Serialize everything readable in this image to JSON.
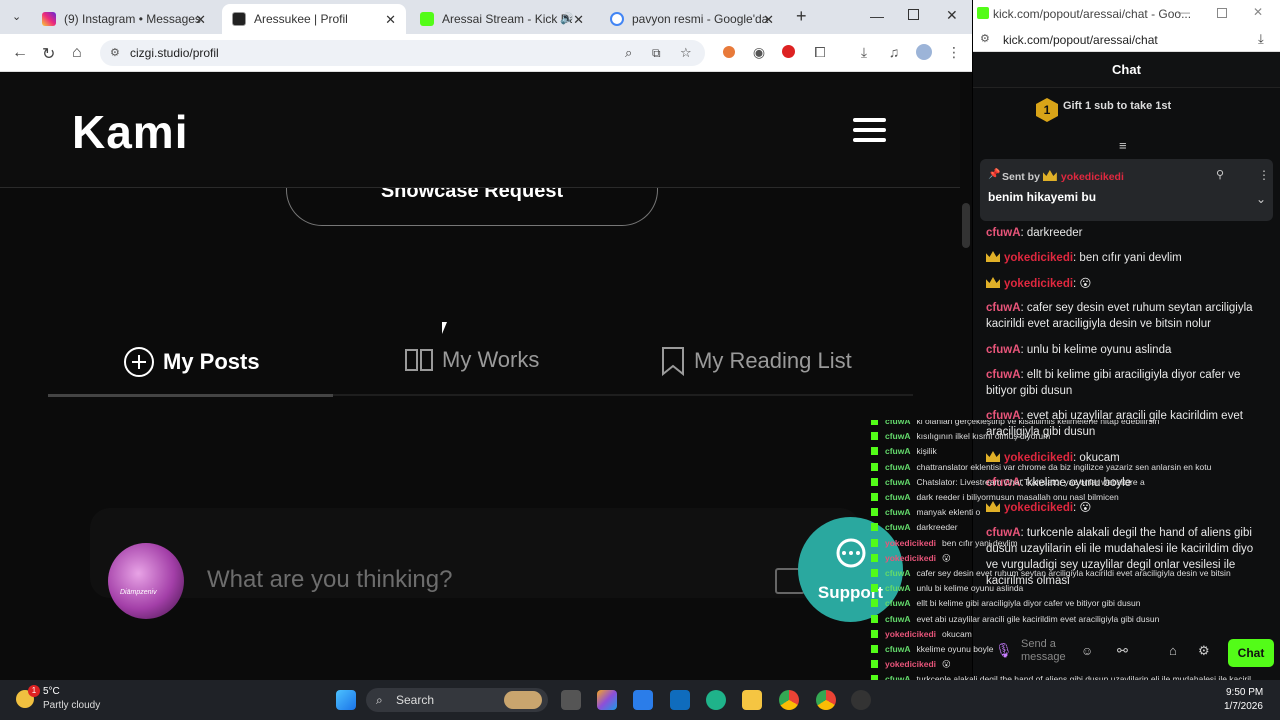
{
  "browser": {
    "tabs": [
      {
        "label": "(9) Instagram • Messages",
        "color": "#d6249f"
      },
      {
        "label": "Aressukee | Profil",
        "color": "#111111"
      },
      {
        "label": "Aressai Stream - Kick Das",
        "color": "#53fc18"
      },
      {
        "label": "pavyon resmi - Google'da ara",
        "color": "#4285f4"
      }
    ],
    "url": "cizgi.studio/profil",
    "new_tab": "+"
  },
  "site": {
    "logo": "Kami",
    "showcase_button": "Showcase Request",
    "tabs": [
      "My Posts",
      "My Works",
      "My Reading List"
    ],
    "post_placeholder": "What are you thinking?",
    "avatar_text": "Diämpzeniv",
    "support_label": "Support"
  },
  "chat": {
    "window_title": "kick.com/popout/aressai/chat - Goo...",
    "url": "kick.com/popout/aressai/chat",
    "header": "Chat",
    "gift_badge": "1",
    "gift_text": "Gift 1 sub to take 1st",
    "pinned": {
      "sent_by": "Sent by",
      "user": "yokedicikedi",
      "text": "benim hikayemi bu"
    },
    "messages": [
      {
        "user": "cfuwA",
        "text": ": darkreeder",
        "sub": false
      },
      {
        "user": "yokedicikedi",
        "text": ": ben cıfır yani devlim",
        "sub": true
      },
      {
        "user": "yokedicikedi",
        "text": ": 😮",
        "sub": true
      },
      {
        "user": "cfuwA",
        "text": ": cafer sey desin evet ruhum seytan arciligiyla kacirildi evet araciligiyla desin ve bitsin nolur",
        "sub": false
      },
      {
        "user": "cfuwA",
        "text": ": unlu bi kelime oyunu aslinda",
        "sub": false
      },
      {
        "user": "cfuwA",
        "text": ": ellt bi kelime gibi araciligiyla diyor cafer ve bitiyor gibi dusun",
        "sub": false
      },
      {
        "user": "cfuwA",
        "text": ": evet abi uzaylilar aracili gile kacirildim evet araciligiyla gibi dusun",
        "sub": false
      },
      {
        "user": "yokedicikedi",
        "text": ": okucam",
        "sub": true
      },
      {
        "user": "cfuwA",
        "text": ": kkelime oyunu boyle",
        "sub": false
      },
      {
        "user": "yokedicikedi",
        "text": ": 😮",
        "sub": true
      },
      {
        "user": "cfuwA",
        "text": ": turkcenle alakali degil the hand of aliens gibi dusun uzaylilarin eli ile mudahalesi ile kacirildim diyo ve vurguladigi sey uzaylilar degil onlar vesilesi ile kacirilmis olmasi",
        "sub": false
      }
    ],
    "input_placeholder": "Send a message",
    "send_label": "Chat"
  },
  "overlay": [
    {
      "user": "cfuwA",
      "text": "ki olanlari gerçekleştirip ve kisaltilmis kelimelerle hitap edebilirsin",
      "red": false
    },
    {
      "user": "cfuwA",
      "text": "kısılıgının ilkel kısmı ölmüş diyorum",
      "red": false
    },
    {
      "user": "cfuwA",
      "text": "kişilik",
      "red": false
    },
    {
      "user": "cfuwA",
      "text": "chattranslator eklentisi var chrome da biz ingilizce yazariz sen anlarsin en kotu",
      "red": false
    },
    {
      "user": "cfuwA",
      "text": "Chatslator: Livestream Chat Translator yaz onlar websitore a",
      "red": false
    },
    {
      "user": "cfuwA",
      "text": "dark reeder i biliyormusun masallah onu nasl bilmicen",
      "red": false
    },
    {
      "user": "cfuwA",
      "text": "manyak eklenti o",
      "red": false
    },
    {
      "user": "cfuwA",
      "text": "darkreeder",
      "red": false
    },
    {
      "user": "yokedicikedi",
      "text": "ben cıfır yani devlim",
      "red": true
    },
    {
      "user": "yokedicikedi",
      "text": "😮",
      "red": true
    },
    {
      "user": "cfuwA",
      "text": "cafer sey desin evet ruhum seytan arciligiyla kacirildi evet araciligiyla desin ve bitsin",
      "red": false
    },
    {
      "user": "cfuwA",
      "text": "unlu bi kelime oyunu aslinda",
      "red": false
    },
    {
      "user": "cfuwA",
      "text": "ellt bi kelime gibi araciligiyla diyor cafer ve bitiyor gibi dusun",
      "red": false
    },
    {
      "user": "cfuwA",
      "text": "evet abi uzaylilar aracili gile kacirildim evet araciligiyla gibi dusun",
      "red": false
    },
    {
      "user": "yokedicikedi",
      "text": "okucam",
      "red": true
    },
    {
      "user": "cfuwA",
      "text": "kkelime oyunu boyle",
      "red": false
    },
    {
      "user": "yokedicikedi",
      "text": "😮",
      "red": true
    },
    {
      "user": "cfuwA",
      "text": "turkcenle alakali degil the hand of aliens gibi dusun uzaylilarin eli ile mudahalesi ile kacirildim diyo ve vurguladigi sey uzaylilar degil onlar vesilesi ile kacirilmis olmasi",
      "red": false
    }
  ],
  "taskbar": {
    "weather_temp": "5°C",
    "weather_desc": "Partly cloudy",
    "weather_badge": "1",
    "search": "Search",
    "time": "9:50 PM",
    "date": "1/7/2026"
  },
  "colors": {
    "kick_green": "#53fc18",
    "support_teal": "#2aa89f"
  }
}
